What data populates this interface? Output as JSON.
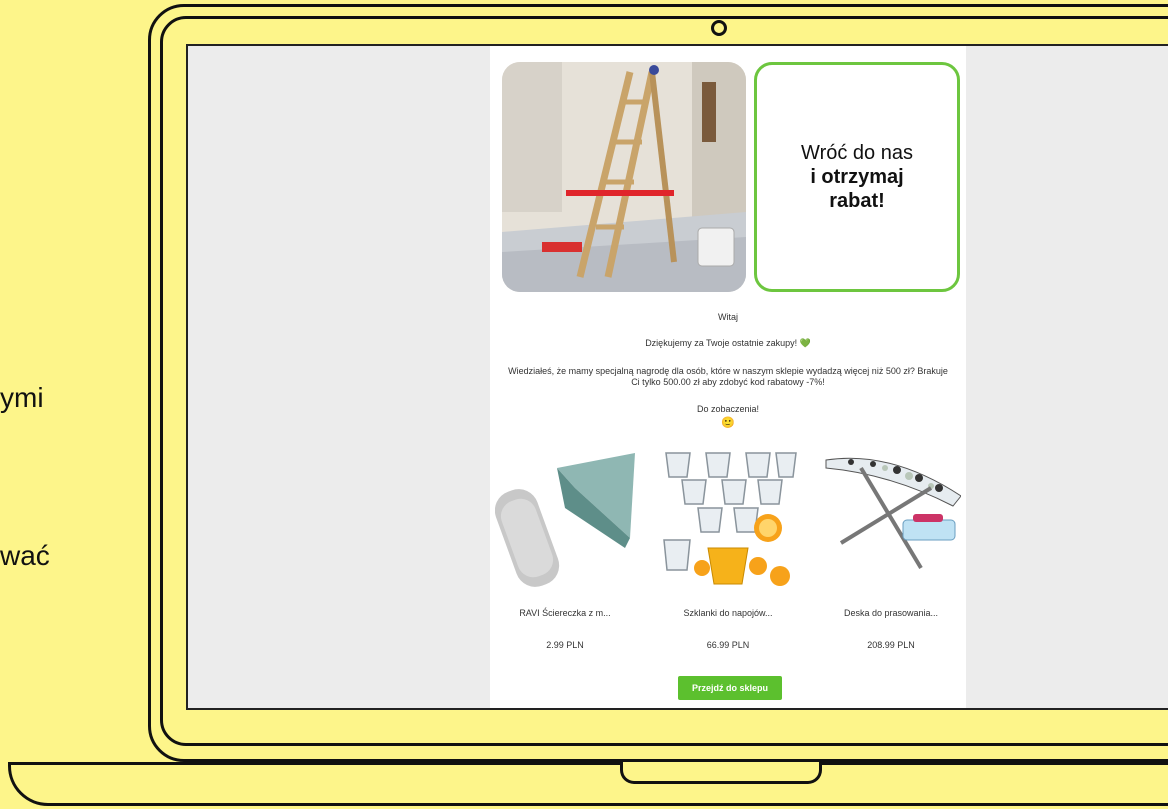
{
  "side_text": [
    "ymi",
    "wać"
  ],
  "email": {
    "hero": {
      "line1": "Wróć do nas",
      "line2": "i otrzymaj",
      "line3": "rabat!"
    },
    "greeting": "Witaj",
    "thanks": "Dziękujemy za Twoje ostatnie zakupy! 💚",
    "offer": "Wiedziałeś, że mamy specjalną nagrodę dla osób, które w naszym sklepie wydadzą więcej niż 500 zł? Brakuje Ci tylko 500.00 zł aby zdobyć kod rabatowy -7%!",
    "bye": "Do zobaczenia!",
    "bye_emoji": "🙂",
    "products": [
      {
        "name": "RAVI Ściereczka z m...",
        "price": "2.99 PLN",
        "icon": "towel-image"
      },
      {
        "name": "Szklanki do napojów...",
        "price": "66.99 PLN",
        "icon": "glasses-image"
      },
      {
        "name": "Deska do prasowania...",
        "price": "208.99 PLN",
        "icon": "ironing-board-image"
      }
    ],
    "cta_label": "Przejdź do sklepu"
  },
  "colors": {
    "background": "#fdf58a",
    "accent": "#5cc02e",
    "card_border": "#6dc63f"
  }
}
